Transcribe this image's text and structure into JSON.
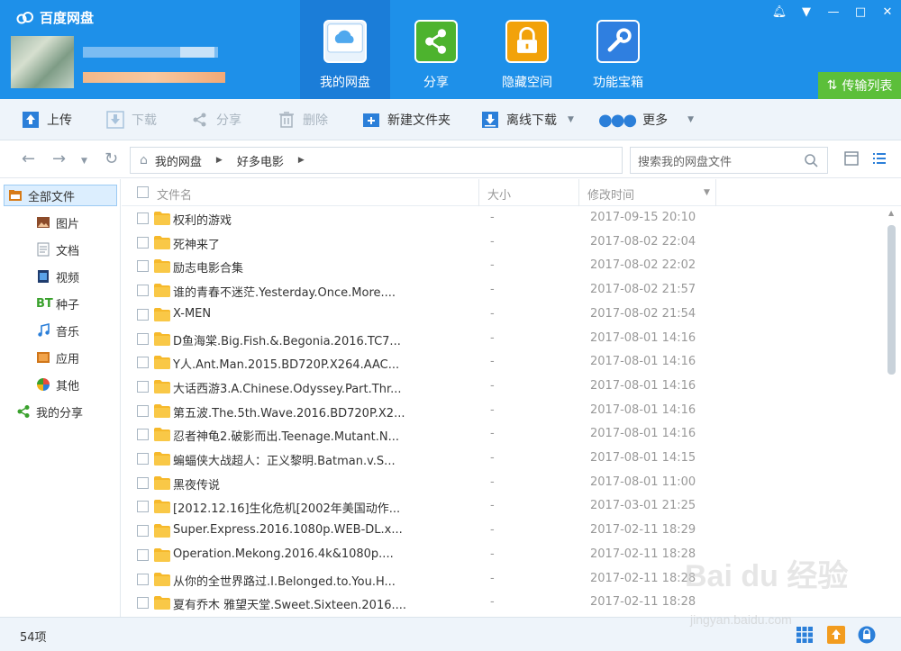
{
  "app": {
    "title": "百度网盘"
  },
  "nav_tabs": [
    {
      "label": "我的网盘",
      "icon": "cloud-drive-icon",
      "active": true,
      "color": "#1b7dd8"
    },
    {
      "label": "分享",
      "icon": "share-icon",
      "color": "#4db32e"
    },
    {
      "label": "隐藏空间",
      "icon": "lock-icon",
      "color": "#f2a20a"
    },
    {
      "label": "功能宝箱",
      "icon": "toolbox-icon",
      "color": "#2f7fe0"
    }
  ],
  "transfer": {
    "label": "传输列表",
    "color": "#5cbf3a"
  },
  "toolbar": {
    "upload": "上传",
    "download": "下载",
    "share": "分享",
    "delete": "删除",
    "new_folder": "新建文件夹",
    "offline_download": "离线下载",
    "more": "更多"
  },
  "breadcrumb": {
    "root": "我的网盘",
    "current": "好多电影"
  },
  "search": {
    "placeholder": "搜索我的网盘文件"
  },
  "sidebar": {
    "items": [
      {
        "label": "全部文件",
        "icon": "all-files-icon",
        "active": true
      },
      {
        "label": "图片",
        "icon": "image-icon"
      },
      {
        "label": "文档",
        "icon": "document-icon"
      },
      {
        "label": "视频",
        "icon": "video-icon"
      },
      {
        "label": "种子",
        "icon": "bt-icon",
        "badge": "BT"
      },
      {
        "label": "音乐",
        "icon": "music-icon"
      },
      {
        "label": "应用",
        "icon": "app-icon"
      },
      {
        "label": "其他",
        "icon": "other-icon"
      },
      {
        "label": "我的分享",
        "icon": "share-icon"
      }
    ]
  },
  "list": {
    "columns": {
      "name": "文件名",
      "size": "大小",
      "modified": "修改时间"
    },
    "rows": [
      {
        "name": "权利的游戏",
        "size": "-",
        "date": "2017-09-15 20:10"
      },
      {
        "name": "死神来了",
        "size": "-",
        "date": "2017-08-02 22:04"
      },
      {
        "name": "励志电影合集",
        "size": "-",
        "date": "2017-08-02 22:02"
      },
      {
        "name": "谁的青春不迷茫.Yesterday.Once.More....",
        "size": "-",
        "date": "2017-08-02 21:57"
      },
      {
        "name": "X-MEN",
        "size": "-",
        "date": "2017-08-02 21:54"
      },
      {
        "name": "D鱼海棠.Big.Fish.&.Begonia.2016.TC7...",
        "size": "-",
        "date": "2017-08-01 14:16"
      },
      {
        "name": "Y人.Ant.Man.2015.BD720P.X264.AAC...",
        "size": "-",
        "date": "2017-08-01 14:16"
      },
      {
        "name": "大话西游3.A.Chinese.Odyssey.Part.Thr...",
        "size": "-",
        "date": "2017-08-01 14:16"
      },
      {
        "name": "第五波.The.5th.Wave.2016.BD720P.X2...",
        "size": "-",
        "date": "2017-08-01 14:16"
      },
      {
        "name": "忍者神龟2.破影而出.Teenage.Mutant.N...",
        "size": "-",
        "date": "2017-08-01 14:16"
      },
      {
        "name": "蝙蝠侠大战超人：正义黎明.Batman.v.S...",
        "size": "-",
        "date": "2017-08-01 14:15"
      },
      {
        "name": "黑夜传说",
        "size": "-",
        "date": "2017-08-01 11:00"
      },
      {
        "name": "[2012.12.16]生化危机[2002年美国动作...",
        "size": "-",
        "date": "2017-03-01 21:25"
      },
      {
        "name": "Super.Express.2016.1080p.WEB-DL.x...",
        "size": "-",
        "date": "2017-02-11 18:29"
      },
      {
        "name": "Operation.Mekong.2016.4k&1080p....",
        "size": "-",
        "date": "2017-02-11 18:28"
      },
      {
        "name": "从你的全世界路过.I.Belonged.to.You.H...",
        "size": "-",
        "date": "2017-02-11 18:28"
      },
      {
        "name": "夏有乔木 雅望天堂.Sweet.Sixteen.2016....",
        "size": "-",
        "date": "2017-02-11 18:28"
      }
    ]
  },
  "status": {
    "count": "54项"
  },
  "watermark": {
    "brand": "Bai du 经验",
    "url": "jingyan.baidu.com"
  },
  "colors": {
    "header": "#1e90e9",
    "folder": "#f6b92b",
    "accent": "#1b7dd8"
  }
}
